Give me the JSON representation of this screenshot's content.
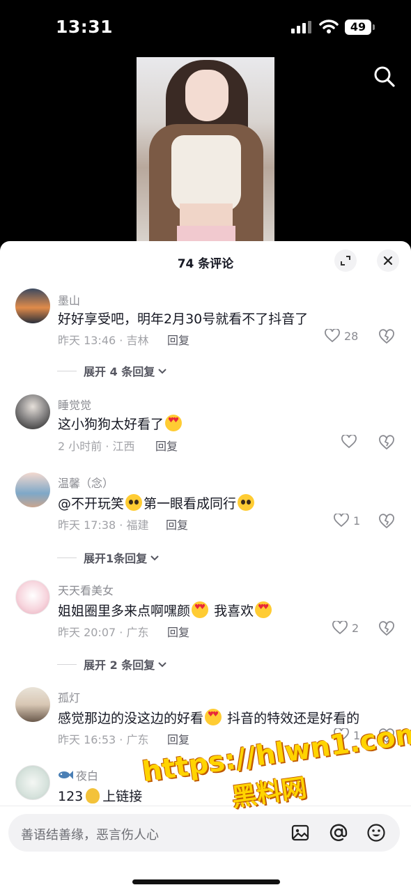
{
  "status_bar": {
    "time": "13:31",
    "battery": "49"
  },
  "sheet": {
    "title": "74 条评论"
  },
  "comments": [
    {
      "username": "墨山",
      "text": "好好享受吧，明年2月30号就看不了抖音了",
      "time_location": "昨天 13:46 · 吉林",
      "reply": "回复",
      "likes": "28",
      "expand": "展开 4 条回复"
    },
    {
      "username": "睡觉觉",
      "text": "这小狗狗太好看了",
      "time_location": "2 小时前 · 江西",
      "reply": "回复",
      "likes": ""
    },
    {
      "username": "温馨（念）",
      "text_a": "@不开玩笑",
      "text_b": "第一眼看成同行",
      "time_location": "昨天 17:38 · 福建",
      "reply": "回复",
      "likes": "1",
      "expand": "展开1条回复"
    },
    {
      "username": "天天看美女",
      "text_a": "姐姐圈里多来点啊嘿颜",
      "text_b": "我喜欢",
      "time_location": "昨天 20:07 · 广东",
      "reply": "回复",
      "likes": "2",
      "expand": "展开 2 条回复"
    },
    {
      "username": "孤灯",
      "text_a": "感觉那边的没这边的好看",
      "text_b": "抖音的特效还是好看的",
      "time_location": "昨天 16:53 · 广东",
      "reply": "回复",
      "likes": "1"
    },
    {
      "username": "夜白",
      "text_a": "123",
      "text_b": "上链接"
    }
  ],
  "input": {
    "placeholder": "善语结善缘，恶言伤人心"
  },
  "watermark": {
    "url": "https://hlwn1.com",
    "name": "黑料网"
  },
  "icons": [
    "search-icon",
    "expand-icon",
    "close-icon",
    "heart-icon",
    "broken-heart-icon",
    "image-icon",
    "at-icon",
    "emoji-icon"
  ]
}
